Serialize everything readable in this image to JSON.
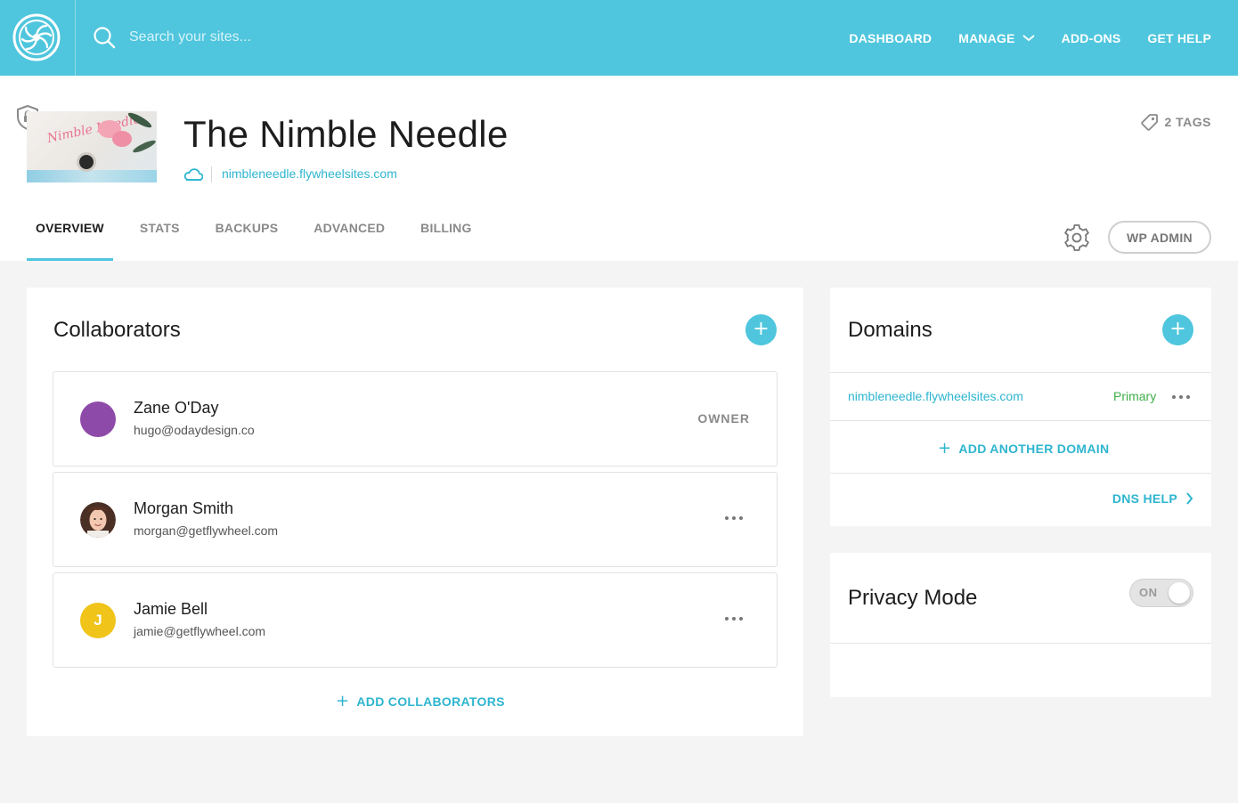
{
  "topbar": {
    "search_placeholder": "Search your sites...",
    "nav": [
      {
        "label": "DASHBOARD"
      },
      {
        "label": "MANAGE"
      },
      {
        "label": "ADD-ONS"
      },
      {
        "label": "GET HELP"
      }
    ]
  },
  "site": {
    "title": "The Nimble Needle",
    "url": "nimbleneedle.flywheelsites.com",
    "thumbnail_text": "Nimble Needle",
    "tags_label": "2 TAGS"
  },
  "tabs": [
    {
      "label": "OVERVIEW",
      "active": true
    },
    {
      "label": "STATS"
    },
    {
      "label": "BACKUPS"
    },
    {
      "label": "ADVANCED"
    },
    {
      "label": "BILLING"
    }
  ],
  "wp_admin_label": "WP ADMIN",
  "collaborators": {
    "title": "Collaborators",
    "add_symbol": "+",
    "people": [
      {
        "name": "Zane O'Day",
        "email": "hugo@odaydesign.co",
        "role": "OWNER",
        "avatar_color": "#8e4aa8"
      },
      {
        "name": "Morgan Smith",
        "email": "morgan@getflywheel.com",
        "avatar_color": "#5a3a2e"
      },
      {
        "name": "Jamie Bell",
        "email": "jamie@getflywheel.com",
        "avatar_letter": "J",
        "avatar_color": "#f0c419"
      }
    ],
    "add_label": "ADD COLLABORATORS"
  },
  "domains": {
    "title": "Domains",
    "add_symbol": "+",
    "items": [
      {
        "url": "nimbleneedle.flywheelsites.com",
        "status": "Primary"
      }
    ],
    "add_label": "ADD ANOTHER DOMAIN",
    "dns_help_label": "DNS HELP"
  },
  "privacy": {
    "title": "Privacy Mode",
    "toggle_label": "ON",
    "enabled": true
  },
  "colors": {
    "accent": "#4fc6dd",
    "link": "#2eb5cf",
    "primary_status": "#3fae49"
  }
}
